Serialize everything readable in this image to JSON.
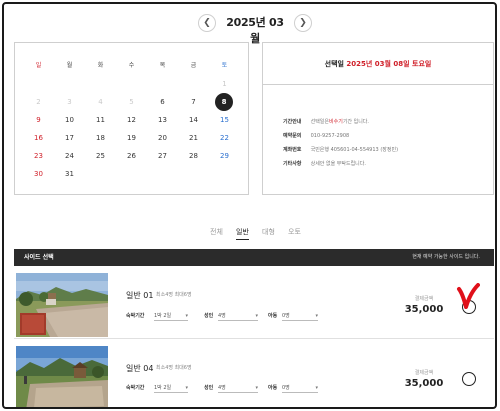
{
  "header": {
    "month_title": "2025년 03월",
    "prev_icon": "chevron-left-icon",
    "next_icon": "chevron-right-icon"
  },
  "calendar": {
    "weekdays": [
      "일",
      "월",
      "화",
      "수",
      "목",
      "금",
      "토"
    ],
    "weeks": [
      [
        "",
        "",
        "",
        "",
        "",
        "",
        "1"
      ],
      [
        "2",
        "3",
        "4",
        "5",
        "6",
        "7",
        "8"
      ],
      [
        "9",
        "10",
        "11",
        "12",
        "13",
        "14",
        "15"
      ],
      [
        "16",
        "17",
        "18",
        "19",
        "20",
        "21",
        "22"
      ],
      [
        "23",
        "24",
        "25",
        "26",
        "27",
        "28",
        "29"
      ],
      [
        "30",
        "31",
        "",
        "",
        "",
        "",
        ""
      ]
    ],
    "selected": "8",
    "disabled": [
      "1",
      "2",
      "3",
      "4",
      "5"
    ]
  },
  "info": {
    "selected_prefix": "선택일",
    "selected_date": "2025년 03월 08일 토요일",
    "rows": [
      {
        "label": "기간안내",
        "prefix": "선택일은",
        "highlight": "비수기",
        "suffix": "기간 입니다."
      },
      {
        "label": "예약문의",
        "value": "010-9257-2908"
      },
      {
        "label": "계좌번호",
        "value": "국민은행 405601-04-554913 (장정민)"
      },
      {
        "label": "기타사항",
        "value": "상세안 없을 부탁드립니다."
      }
    ]
  },
  "tabs": [
    "전체",
    "일반",
    "대형",
    "오토"
  ],
  "active_tab": "일반",
  "site_bar": {
    "left": "사이드 선택",
    "right": "현재 예약 가능한 사이드 입니다."
  },
  "sites": [
    {
      "name": "일반 01",
      "capacity": "최소4명 최대6명",
      "period_label": "숙박기간",
      "period_value": "1박 2일",
      "adult_label": "성인",
      "adult_value": "4명",
      "child_label": "아동",
      "child_value": "0명",
      "price_label": "결제금액",
      "price": "35,000",
      "selected_mark": true
    },
    {
      "name": "일반 04",
      "capacity": "최소4명 최대6명",
      "period_label": "숙박기간",
      "period_value": "1박 2일",
      "adult_label": "성인",
      "adult_value": "4명",
      "child_label": "아동",
      "child_value": "0명",
      "price_label": "결제금액",
      "price": "35,000",
      "selected_mark": false
    }
  ],
  "colors": {
    "accent_red": "#d0202a",
    "saturday_blue": "#2a6fcf",
    "bar_dark": "#2b2b2b"
  }
}
